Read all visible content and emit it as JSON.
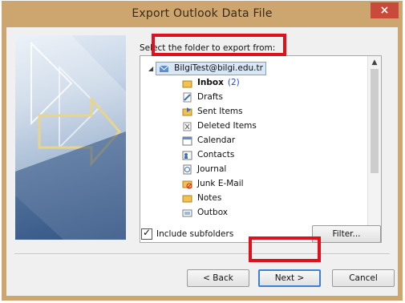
{
  "window": {
    "title": "Export Outlook Data File",
    "close_label": "×"
  },
  "prompt": "Select the folder to export from:",
  "tree": {
    "root": {
      "label": "BilgiTest@bilgi.edu.tr",
      "icon": "mail-account-icon"
    },
    "items": [
      {
        "label": "Inbox",
        "count": "(2)",
        "icon": "inbox-icon"
      },
      {
        "label": "Drafts",
        "icon": "drafts-icon"
      },
      {
        "label": "Sent Items",
        "icon": "sent-items-icon"
      },
      {
        "label": "Deleted Items",
        "icon": "deleted-items-icon"
      },
      {
        "label": "Calendar",
        "icon": "calendar-icon"
      },
      {
        "label": "Contacts",
        "icon": "contacts-icon"
      },
      {
        "label": "Journal",
        "icon": "journal-icon"
      },
      {
        "label": "Junk E-Mail",
        "icon": "junk-mail-icon"
      },
      {
        "label": "Notes",
        "icon": "notes-icon"
      },
      {
        "label": "Outbox",
        "icon": "outbox-icon"
      }
    ]
  },
  "include_subfolders": {
    "label": "Include subfolders",
    "checked": true
  },
  "buttons": {
    "filter": "Filter...",
    "back": "< Back",
    "next": "Next >",
    "cancel": "Cancel"
  },
  "colors": {
    "frame": "#cda66f",
    "highlight": "#e0101c",
    "close": "#c74a3a"
  }
}
